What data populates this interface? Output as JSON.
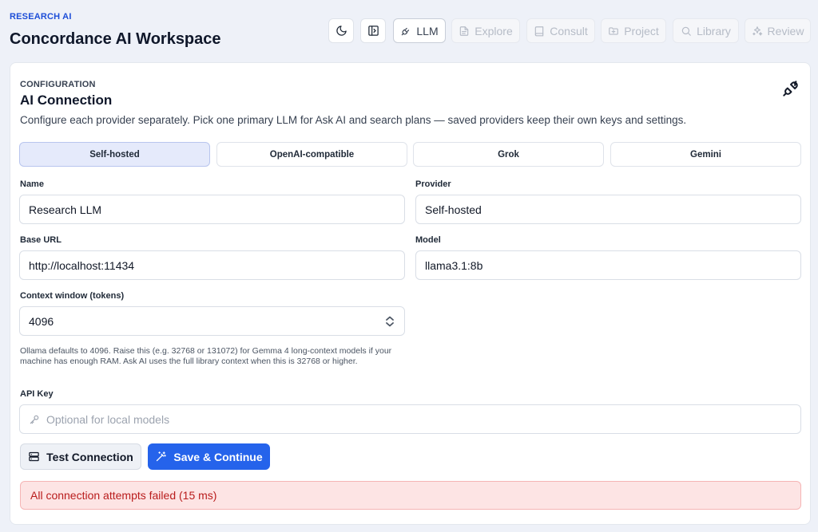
{
  "header": {
    "brand_tag": "RESEARCH AI",
    "title": "Concordance AI Workspace"
  },
  "topnav": {
    "theme_toggle_icon": "moon-icon",
    "panel_toggle_icon": "sidebar-panel-icon",
    "items": [
      {
        "label": "LLM",
        "icon": "plug-icon",
        "state": "active"
      },
      {
        "label": "Explore",
        "icon": "document-icon",
        "state": "disabled"
      },
      {
        "label": "Consult",
        "icon": "book-icon",
        "state": "disabled"
      },
      {
        "label": "Project",
        "icon": "folder-plus-icon",
        "state": "disabled"
      },
      {
        "label": "Library",
        "icon": "search-icon",
        "state": "disabled"
      },
      {
        "label": "Review",
        "icon": "sparkles-icon",
        "state": "disabled"
      }
    ]
  },
  "config": {
    "eyebrow": "CONFIGURATION",
    "title": "AI Connection",
    "description": "Configure each provider separately. Pick one primary LLM for Ask AI and search plans — saved providers keep their own keys and settings.",
    "corner_icon": "plug-icon",
    "provider_tabs": [
      {
        "label": "Self-hosted",
        "selected": true
      },
      {
        "label": "OpenAI-compatible",
        "selected": false
      },
      {
        "label": "Grok",
        "selected": false
      },
      {
        "label": "Gemini",
        "selected": false
      }
    ],
    "fields": {
      "name": {
        "label": "Name",
        "value": "Research LLM"
      },
      "provider": {
        "label": "Provider",
        "value": "Self-hosted"
      },
      "base_url": {
        "label": "Base URL",
        "value": "http://localhost:11434"
      },
      "model": {
        "label": "Model",
        "value": "llama3.1:8b"
      },
      "context_window": {
        "label": "Context window (tokens)",
        "value": "4096"
      },
      "api_key": {
        "label": "API Key",
        "value": "",
        "placeholder": "Optional for local models"
      }
    },
    "help_text": "Ollama defaults to 4096. Raise this (e.g. 32768 or 131072) for Gemma 4 long-context models if your machine has enough RAM. Ask AI uses the full library context when this is 32768 or higher.",
    "buttons": {
      "test_label": "Test Connection",
      "save_label": "Save & Continue"
    },
    "alert": "All connection attempts failed (15 ms)"
  },
  "colors": {
    "accent": "#2563eb",
    "brand": "#1d4ed8",
    "error_bg": "#fde4e4",
    "error_text": "#b91c1c",
    "tab_selected_bg": "#e5eafb"
  }
}
